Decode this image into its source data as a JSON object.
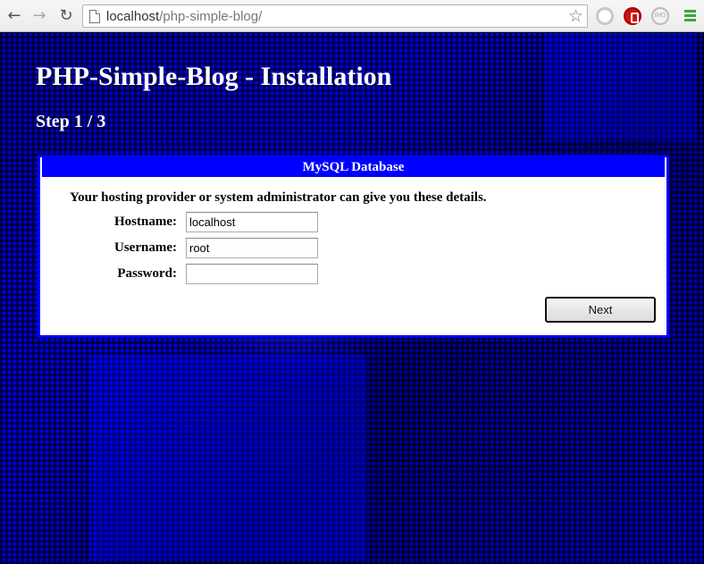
{
  "browser": {
    "url_host": "localhost",
    "url_path": "/php-simple-blog/"
  },
  "page": {
    "heading": "PHP-Simple-Blog - Installation",
    "step": "Step 1 / 3"
  },
  "panel": {
    "title": "MySQL Database",
    "hint": "Your hosting provider or system administrator can give you these details.",
    "fields": [
      {
        "label": "Hostname:",
        "value": "localhost"
      },
      {
        "label": "Username:",
        "value": "root"
      },
      {
        "label": "Password:",
        "value": ""
      }
    ],
    "next_label": "Next"
  },
  "colors": {
    "accent": "#0000ff"
  }
}
